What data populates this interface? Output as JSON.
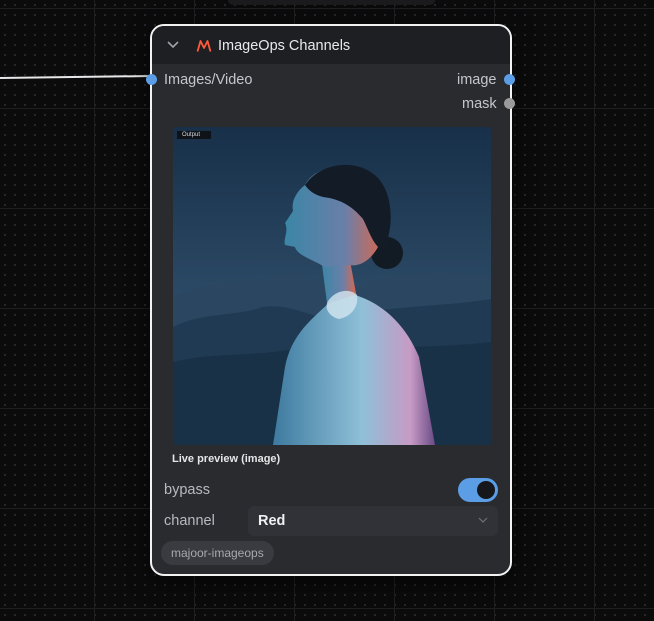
{
  "node": {
    "title": "ImageOps Channels",
    "inputs": [
      {
        "label": "Images/Video",
        "color": "#5b9ee6"
      }
    ],
    "outputs": [
      {
        "label": "image",
        "color": "#5b9ee6"
      },
      {
        "label": "mask",
        "color": "#9a9a9a"
      }
    ],
    "preview": {
      "tag": "Output",
      "caption": "Live preview (image)"
    },
    "widgets": {
      "bypass": {
        "label": "bypass",
        "enabled": true
      },
      "channel": {
        "label": "channel",
        "value": "Red"
      }
    },
    "badge": "majoor-imageops"
  },
  "colors": {
    "accent": "#5b9ee6",
    "logo": "#ff5a3c",
    "selected_outline": "#f2f2f2"
  },
  "icons": [
    "chevron-down-icon",
    "imageops-logo-icon",
    "chevron-down-icon"
  ]
}
